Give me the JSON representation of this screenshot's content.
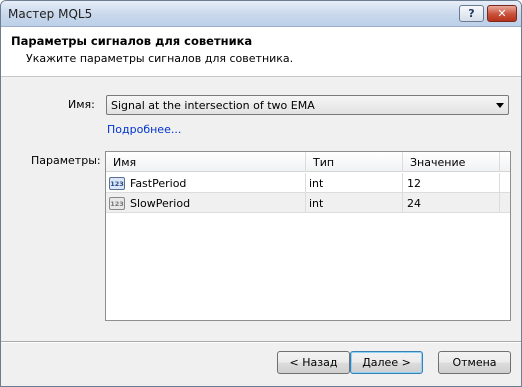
{
  "window": {
    "title": "Мастер MQL5",
    "help_glyph": "?",
    "close_glyph": "✕"
  },
  "header": {
    "title": "Параметры сигналов для советника",
    "subtitle": "Укажите параметры сигналов для советника."
  },
  "form": {
    "name_label": "Имя:",
    "name_value": "Signal at the intersection of two EMA",
    "more_link": "Подробнее...",
    "params_label": "Параметры:"
  },
  "grid": {
    "columns": [
      "Имя",
      "Тип",
      "Значение"
    ],
    "rows": [
      {
        "name": "FastPeriod",
        "type": "int",
        "value": "12",
        "icon": "number-param-icon"
      },
      {
        "name": "SlowPeriod",
        "type": "int",
        "value": "24",
        "icon": "number-param-icon"
      }
    ],
    "icon_glyph": "123"
  },
  "buttons": {
    "back": "< Назад",
    "next": "Далее >",
    "cancel": "Отмена"
  }
}
